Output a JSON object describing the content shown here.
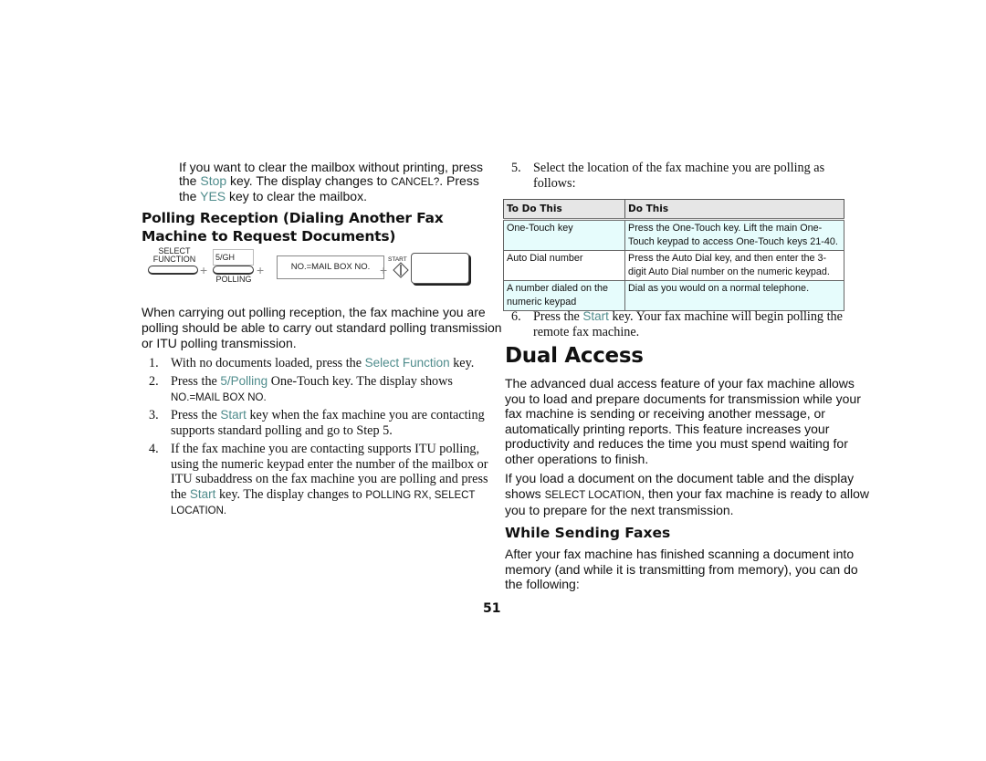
{
  "intro": {
    "t1": "If you want to clear the mailbox without printing, press the ",
    "key1": "Stop",
    "t2": " key. The display changes to ",
    "disp1": "CANCEL?",
    "t3": ". Press the ",
    "key2": "YES",
    "t4": " key to clear the mailbox."
  },
  "polling_heading": "Polling Reception (Dialing Another Fax Machine to Request Documents)",
  "diagram": {
    "select_label_1": "SELECT",
    "select_label_2": "FUNCTION",
    "key_5gh": "5/GH",
    "polling_label": "POLLING",
    "display_text": "NO.=MAIL BOX NO.",
    "start_label": "START",
    "plus": "+"
  },
  "polling_para": "When carrying out polling reception, the fax machine you are polling should be able to carry out standard polling transmission or ITU polling transmission.",
  "steps": [
    {
      "num": "1.",
      "a": "With no documents loaded, press the ",
      "key": "Select Function",
      "b": " key.",
      "disp": ""
    },
    {
      "num": "2.",
      "a": "Press the ",
      "key": "5/Polling",
      "b": " One-Touch key. The display shows",
      "disp": "NO.=MAIL BOX NO."
    },
    {
      "num": "3.",
      "a": "Press the ",
      "key": "Start",
      "b": " key when the fax machine you are contacting supports standard polling and go to Step 5.",
      "disp": ""
    },
    {
      "num": "4.",
      "a": "If the fax machine you are contacting supports ITU polling, using the numeric keypad enter the number of the mailbox or ITU subaddress on the fax machine you are polling and press the ",
      "key": "Start",
      "b": " key. The display changes to ",
      "disp": "POLLING RX, SELECT LOCATION."
    },
    {
      "num": "5.",
      "a": "Select the location of the fax machine you are polling as follows:",
      "key": "",
      "b": "",
      "disp": ""
    },
    {
      "num": "6.",
      "a": "Press the ",
      "key": "Start",
      "b": " key. Your fax machine will begin polling the remote fax machine.",
      "disp": ""
    }
  ],
  "table": {
    "headers": [
      "To Do This",
      "Do This"
    ],
    "rows": [
      [
        "One-Touch key",
        "Press the One-Touch key. Lift the main One-Touch keypad to access One-Touch keys 21-40."
      ],
      [
        "Auto Dial number",
        "Press the Auto Dial key, and then enter the 3-digit Auto Dial number on the numeric keypad."
      ],
      [
        "A number dialed on the numeric keypad",
        "Dial as you would on a normal telephone."
      ]
    ]
  },
  "dual_heading": "Dual Access",
  "dual_para1": "The advanced dual access feature of your fax machine allows you to load and prepare documents for transmission while your fax machine is sending or receiving another message, or automatically printing reports. This feature increases your productivity and reduces the time you must spend waiting for other operations to finish.",
  "dual_para2": {
    "a": "If you load a document on the document table and the display shows ",
    "disp": "SELECT LOCATION",
    "b": ", then your fax machine is ready to allow you to prepare for the next transmission."
  },
  "sending_heading": "While Sending Faxes",
  "sending_para": "After your fax machine has finished scanning a document into memory (and while it is transmitting from memory), you can do the following:",
  "page_number": "51",
  "colors": {
    "key_text": "#4f8c8c",
    "table_header": "#e6e6e6",
    "table_row_alt": "#e6fcfc"
  }
}
